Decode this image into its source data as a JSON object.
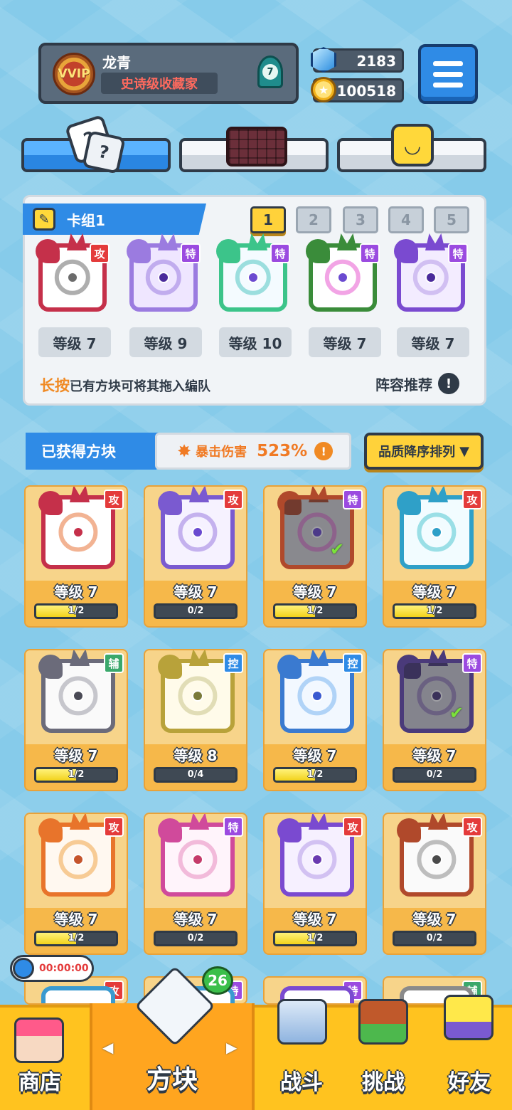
{
  "profile": {
    "name": "龙青",
    "title": "史诗级收藏家",
    "vip_label": "VVIP",
    "rank": "7"
  },
  "currency": {
    "gems": "2183",
    "coins": "100518"
  },
  "deck": {
    "name": "卡组1",
    "slots": [
      "1",
      "2",
      "3",
      "4",
      "5"
    ],
    "cards": [
      {
        "tag": "攻",
        "level": "等级 7",
        "color": "#c5304a",
        "sym": "#6b6b6b",
        "dot": "#6b6b6b",
        "bg": "#ffffff",
        "tagc": "atk"
      },
      {
        "tag": "特",
        "level": "等级 9",
        "color": "#9b7be0",
        "sym": "#9b7be0",
        "dot": "#4a2a9b",
        "bg": "#efe6ff",
        "tagc": "spe"
      },
      {
        "tag": "特",
        "level": "等级 10",
        "color": "#3cc48a",
        "sym": "#52c7c2",
        "dot": "#6a4ad0",
        "bg": "#f4fbff",
        "tagc": "spe"
      },
      {
        "tag": "特",
        "level": "等级 7",
        "color": "#3a8c3a",
        "sym": "#e85ad0",
        "dot": "#6a4ad0",
        "bg": "#ffffff",
        "tagc": "spe"
      },
      {
        "tag": "特",
        "level": "等级 7",
        "color": "#7a4ad0",
        "sym": "#b49be8",
        "dot": "#4a2a9b",
        "bg": "#f3ecff",
        "tagc": "spe"
      }
    ],
    "tip_highlight": "长按",
    "tip": "已有方块可将其拖入编队",
    "recommend": "阵容推荐"
  },
  "collection": {
    "title": "已获得方块",
    "crit_label": "暴击伤害",
    "crit_value": "523%",
    "sort_label": "品质降序排列",
    "cards": [
      {
        "tag": "攻",
        "tagc": "atk",
        "level": "等级 7",
        "progress": "1/2",
        "frac": 0.5,
        "color": "#c5304a",
        "sym": "#e8743a",
        "dot": "#c5304a",
        "bg": "#fff",
        "dim": false
      },
      {
        "tag": "攻",
        "tagc": "atk",
        "level": "等级 7",
        "progress": "0/2",
        "frac": 0,
        "color": "#7a5ad0",
        "sym": "#9b7be0",
        "dot": "#6a4ad0",
        "bg": "#f6f2ff",
        "dim": false
      },
      {
        "tag": "特",
        "tagc": "spe",
        "level": "等级 7",
        "progress": "1/2",
        "frac": 0.5,
        "color": "#b0492b",
        "sym": "#e85ad0",
        "dot": "#6a4ad0",
        "bg": "#d9d9d9",
        "dim": true
      },
      {
        "tag": "攻",
        "tagc": "atk",
        "level": "等级 7",
        "progress": "1/2",
        "frac": 0.5,
        "color": "#2fa0c8",
        "sym": "#52c7d2",
        "dot": "#2fa0c8",
        "bg": "#f2fcff",
        "dim": false
      },
      {
        "tag": "辅",
        "tagc": "sup",
        "level": "等级 7",
        "progress": "1/2",
        "frac": 0.5,
        "color": "#6b6b7a",
        "sym": "#9a9aa5",
        "dot": "#4a4a55",
        "bg": "#fafafa",
        "dim": false
      },
      {
        "tag": "控",
        "tagc": "ctl",
        "level": "等级 8",
        "progress": "0/4",
        "frac": 0,
        "color": "#b8a23a",
        "sym": "#c9c48a",
        "dot": "#7a7a3a",
        "bg": "#fffbea",
        "dim": false
      },
      {
        "tag": "控",
        "tagc": "ctl",
        "level": "等级 7",
        "progress": "1/2",
        "frac": 0.5,
        "color": "#3a7ad0",
        "sym": "#7ab4f0",
        "dot": "#3a5ad0",
        "bg": "#f2f8ff",
        "dim": false
      },
      {
        "tag": "特",
        "tagc": "spe",
        "level": "等级 7",
        "progress": "0/2",
        "frac": 0,
        "color": "#4a3a7a",
        "sym": "#7a5ab0",
        "dot": "#4a3a7a",
        "bg": "#cfcfd8",
        "dim": true
      },
      {
        "tag": "攻",
        "tagc": "atk",
        "level": "等级 7",
        "progress": "1/2",
        "frac": 0.5,
        "color": "#e8742b",
        "sym": "#f0a54a",
        "dot": "#c5542b",
        "bg": "#fff8f0",
        "dim": false
      },
      {
        "tag": "特",
        "tagc": "spe",
        "level": "等级 7",
        "progress": "0/2",
        "frac": 0,
        "color": "#d04a9b",
        "sym": "#e88ac0",
        "dot": "#c53a6a",
        "bg": "#fff4fb",
        "dim": false
      },
      {
        "tag": "攻",
        "tagc": "atk",
        "level": "等级 7",
        "progress": "1/2",
        "frac": 0.5,
        "color": "#7a4ad0",
        "sym": "#b49be8",
        "dot": "#6a3ab0",
        "bg": "#f6f0ff",
        "dim": false
      },
      {
        "tag": "攻",
        "tagc": "atk",
        "level": "等级 7",
        "progress": "0/2",
        "frac": 0,
        "color": "#b0492b",
        "sym": "#8a8a8a",
        "dot": "#4a4a4a",
        "bg": "#fafafa",
        "dim": false
      }
    ],
    "partial": [
      {
        "tag": "攻",
        "tagc": "atk",
        "color": "#3a9ad0"
      },
      {
        "tag": "特",
        "tagc": "spe",
        "color": "#3a9ad0"
      },
      {
        "tag": "特",
        "tagc": "spe",
        "color": "#7a4ad0"
      },
      {
        "tag": "辅",
        "tagc": "sup",
        "color": "#8a8a8a"
      }
    ]
  },
  "timer": "00:00:00",
  "nav": {
    "shop": "商店",
    "blocks": "方块",
    "battle": "战斗",
    "challenge": "挑战",
    "friends": "好友",
    "badge": "26"
  },
  "icons": [
    "gem-icon",
    "coin-icon",
    "menu-icon",
    "dice-icon",
    "chocolate-icon",
    "smile-block-icon",
    "pencil-icon",
    "exclamation-icon",
    "clock-icon",
    "shop-icon",
    "blocks-icon",
    "battle-icon",
    "challenge-icon",
    "friends-icon"
  ]
}
